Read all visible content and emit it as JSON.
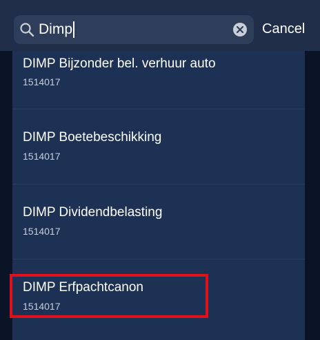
{
  "search": {
    "value": "Dimp",
    "cancel_label": "Cancel",
    "icon": "search-icon",
    "clear_icon": "clear-icon"
  },
  "results": [
    {
      "title": "DIMP Bijzonder bel. verhuur auto",
      "code": "1514017"
    },
    {
      "title": "DIMP Boetebeschikking",
      "code": "1514017"
    },
    {
      "title": "DIMP Dividendbelasting",
      "code": "1514017"
    },
    {
      "title": "DIMP Erfpachtcanon",
      "code": "1514017"
    }
  ],
  "colors": {
    "background": "#0b1426",
    "list_background": "#1d3155",
    "search_field": "#2e3d59",
    "highlight": "#e0101a"
  }
}
